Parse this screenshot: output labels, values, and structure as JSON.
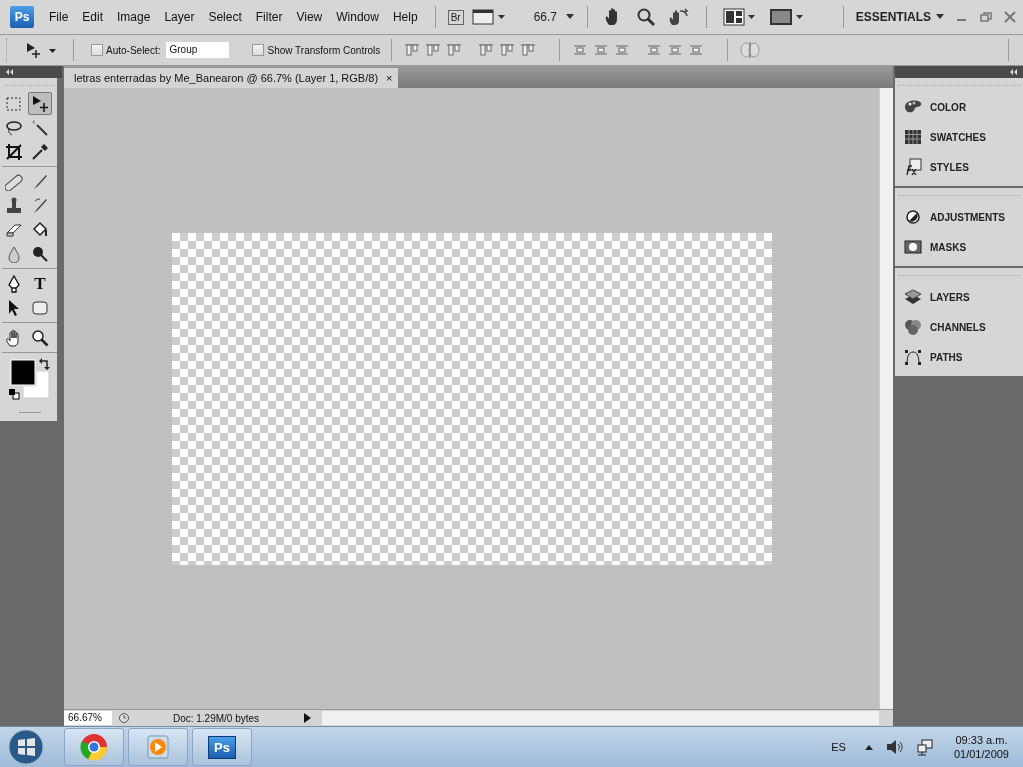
{
  "app": {
    "logo": "Ps",
    "menu": [
      "File",
      "Edit",
      "Image",
      "Layer",
      "Select",
      "Filter",
      "View",
      "Window",
      "Help"
    ],
    "bridge": "Br",
    "zoom": "66.7",
    "workspace": "ESSENTIALS"
  },
  "options": {
    "auto_select": {
      "label": "Auto-Select:",
      "checked": false,
      "value": "Group"
    },
    "transform_controls": {
      "label": "Show Transform Controls",
      "checked": false
    }
  },
  "document": {
    "title": "letras enterradas by Me_Banearon @ 66.7% (Layer 1, RGB/8)",
    "close": "×"
  },
  "tools": [
    {
      "kind": "marquee",
      "selected": false
    },
    {
      "kind": "move",
      "selected": true
    },
    {
      "kind": "lasso",
      "selected": false
    },
    {
      "kind": "wand",
      "selected": false
    },
    {
      "kind": "crop",
      "selected": false
    },
    {
      "kind": "eyedropper",
      "selected": false
    },
    {
      "kind": "healing",
      "selected": false
    },
    {
      "kind": "brush",
      "selected": false
    },
    {
      "kind": "stamp",
      "selected": false
    },
    {
      "kind": "history",
      "selected": false
    },
    {
      "kind": "eraser",
      "selected": false
    },
    {
      "kind": "bucket",
      "selected": false
    },
    {
      "kind": "blur",
      "selected": false
    },
    {
      "kind": "dodge",
      "selected": false
    },
    {
      "kind": "pen",
      "selected": false
    },
    {
      "kind": "type",
      "selected": false,
      "glyph": "T"
    },
    {
      "kind": "arrow",
      "selected": false
    },
    {
      "kind": "shape",
      "selected": false
    },
    {
      "kind": "hand",
      "selected": false
    },
    {
      "kind": "zoom",
      "selected": false
    }
  ],
  "panels": [
    [
      {
        "kind": "color",
        "label": "COLOR"
      },
      {
        "kind": "swatches",
        "label": "SWATCHES"
      },
      {
        "kind": "styles",
        "label": "STYLES"
      }
    ],
    [
      {
        "kind": "adjustments",
        "label": "ADJUSTMENTS"
      },
      {
        "kind": "masks",
        "label": "MASKS"
      }
    ],
    [
      {
        "kind": "layers",
        "label": "LAYERS"
      },
      {
        "kind": "channels",
        "label": "CHANNELS"
      },
      {
        "kind": "paths",
        "label": "PATHS"
      }
    ]
  ],
  "status_bar": {
    "zoom": "66.67%",
    "doc": "Doc: 1.29M/0 bytes"
  },
  "taskbar": {
    "apps": [
      {
        "kind": "browser"
      },
      {
        "kind": "media"
      },
      {
        "kind": "photoshop",
        "label": "Ps"
      }
    ],
    "language": "ES",
    "time": "09:33 a.m.",
    "date": "01/01/2009"
  }
}
